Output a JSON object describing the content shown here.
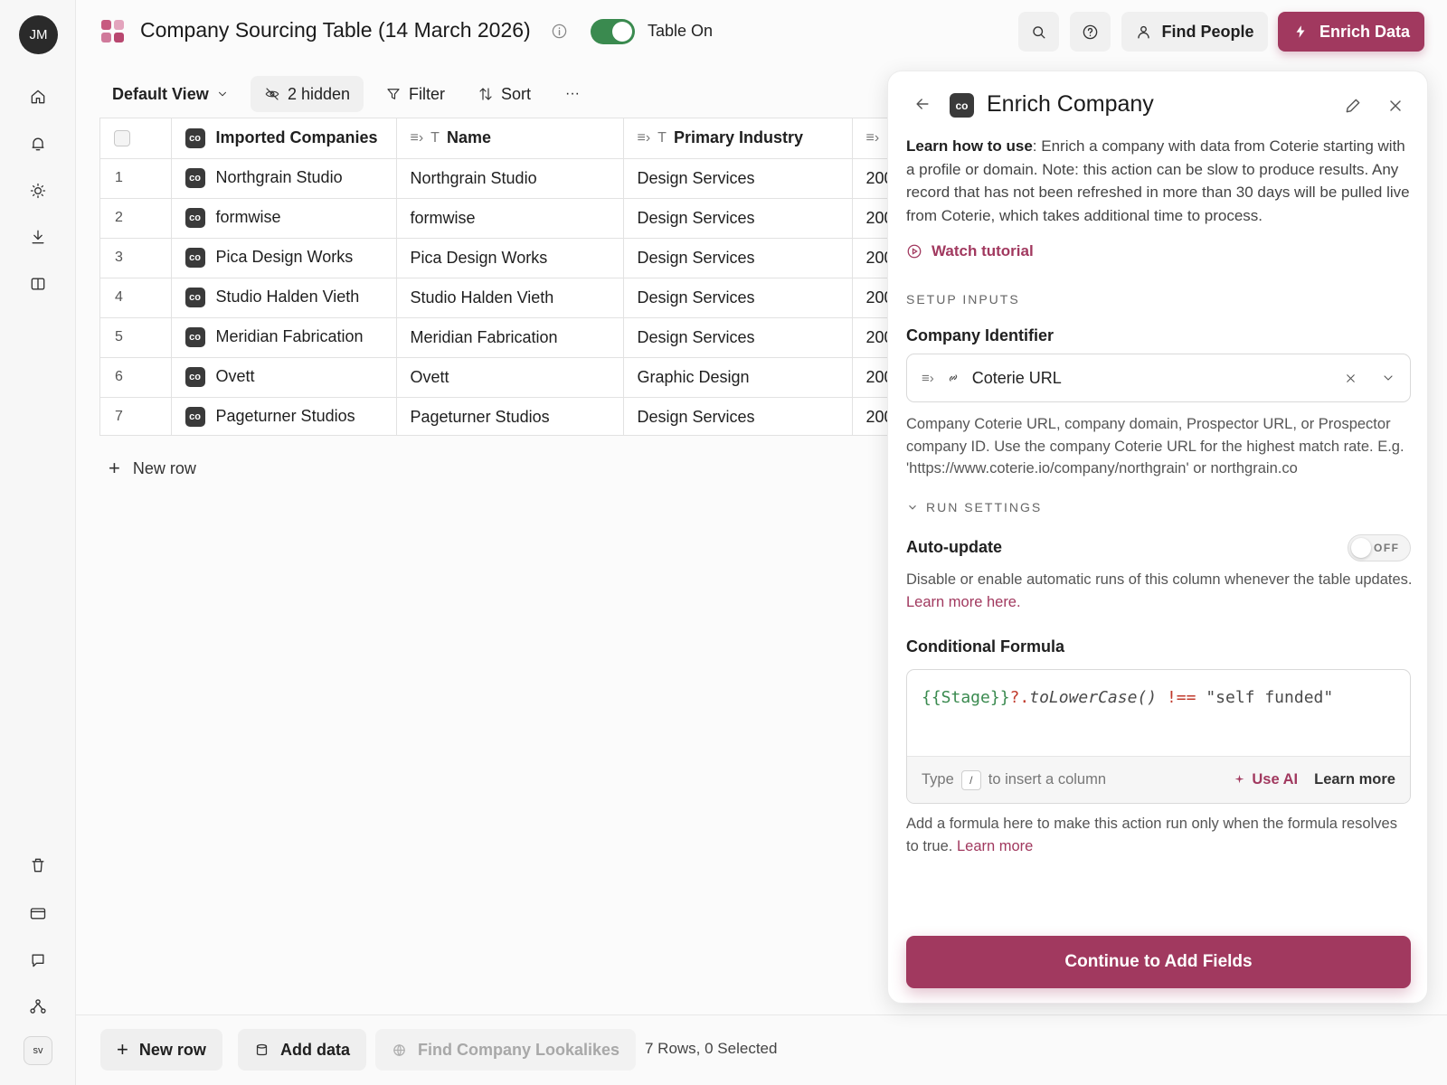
{
  "user": {
    "initials": "JM",
    "workspace_badge": "sv"
  },
  "header": {
    "title": "Company Sourcing Table (14 March 2026)",
    "toggle_label": "Table On",
    "find_people": "Find People",
    "enrich_data": "Enrich Data",
    "colors": {
      "accent": "#a1395f",
      "toggle_on": "#3a8a4f"
    }
  },
  "toolbar": {
    "view": "Default View",
    "hidden": "2 hidden",
    "filter": "Filter",
    "sort": "Sort",
    "more": "···"
  },
  "table": {
    "columns": [
      {
        "label": "Imported Companies",
        "icon": "co"
      },
      {
        "label": "Name",
        "icon": "T"
      },
      {
        "label": "Primary Industry",
        "icon": "T"
      },
      {
        "label": "",
        "icon": "list"
      }
    ],
    "rows": [
      {
        "num": "1",
        "imported": "Northgrain Studio",
        "name": "Northgrain Studio",
        "industry": "Design Services",
        "extra": "200"
      },
      {
        "num": "2",
        "imported": "formwise",
        "name": "formwise",
        "industry": "Design Services",
        "extra": "200"
      },
      {
        "num": "3",
        "imported": "Pica Design Works",
        "name": "Pica Design Works",
        "industry": "Design Services",
        "extra": "200"
      },
      {
        "num": "4",
        "imported": "Studio Halden Vieth",
        "name": "Studio Halden Vieth",
        "industry": "Design Services",
        "extra": "200"
      },
      {
        "num": "5",
        "imported": "Meridian Fabrication",
        "name": "Meridian Fabrication",
        "industry": "Design Services",
        "extra": "200"
      },
      {
        "num": "6",
        "imported": "Ovett",
        "name": "Ovett",
        "industry": "Graphic Design",
        "extra": "200"
      },
      {
        "num": "7",
        "imported": "Pageturner Studios",
        "name": "Pageturner Studios",
        "industry": "Design Services",
        "extra": "200"
      }
    ],
    "co_badge": "co",
    "new_row": "New row"
  },
  "footer": {
    "new_row": "New row",
    "add_data": "Add data",
    "lookalikes": "Find Company Lookalikes",
    "status": "7 Rows, 0 Selected"
  },
  "panel": {
    "badge": "co",
    "title": "Enrich Company",
    "learn_label": "Learn how to use",
    "learn_text": ": Enrich a company with data from Coterie starting with a profile or domain. Note: this action can be slow to produce results. Any record that has not been refreshed in more than 30 days will be pulled live from Coterie, which takes additional time to process.",
    "watch_tutorial": "Watch tutorial",
    "setup_inputs": "SETUP INPUTS",
    "company_identifier": "Company Identifier",
    "identifier_value": "Coterie URL",
    "identifier_help": "Company Coterie URL, company domain, Prospector URL, or Prospector company ID. Use the company Coterie URL for the highest match rate. E.g. 'https://www.coterie.io/company/northgrain' or northgrain.co",
    "run_settings": "RUN SETTINGS",
    "auto_update": "Auto-update",
    "auto_update_state": "OFF",
    "auto_update_help": "Disable or enable automatic runs of this column whenever the table updates.",
    "auto_update_link": "Learn more here.",
    "conditional_formula": "Conditional Formula",
    "formula": {
      "var": "{{Stage}}",
      "chain": "?.",
      "method": "toLowerCase()",
      "op": "!==",
      "str": "\"self funded\""
    },
    "formula_hint_pre": "Type",
    "formula_hint_key": "/",
    "formula_hint_post": "to insert a column",
    "use_ai": "Use AI",
    "learn_more": "Learn more",
    "formula_help": "Add a formula here to make this action run only when the formula resolves to true.",
    "formula_help_link": "Learn more",
    "continue": "Continue to Add Fields"
  }
}
